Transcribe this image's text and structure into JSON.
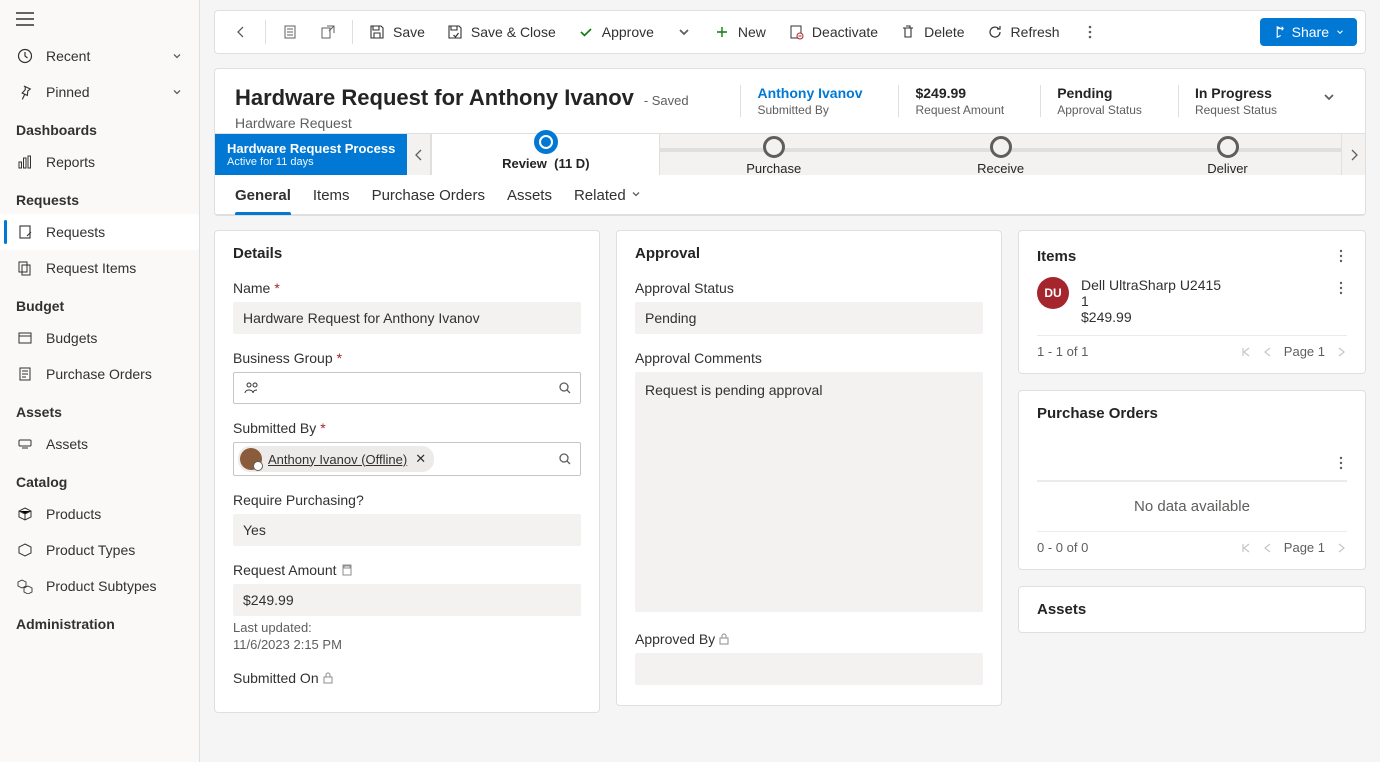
{
  "sidebar": {
    "recent": "Recent",
    "pinned": "Pinned",
    "sections": {
      "dashboards": {
        "header": "Dashboards",
        "reports": "Reports"
      },
      "requests": {
        "header": "Requests",
        "requests": "Requests",
        "request_items": "Request Items"
      },
      "budget": {
        "header": "Budget",
        "budgets": "Budgets",
        "purchase_orders": "Purchase Orders"
      },
      "assets": {
        "header": "Assets",
        "assets": "Assets"
      },
      "catalog": {
        "header": "Catalog",
        "products": "Products",
        "product_types": "Product Types",
        "product_subtypes": "Product Subtypes"
      },
      "administration": {
        "header": "Administration"
      }
    }
  },
  "commands": {
    "save": "Save",
    "save_close": "Save & Close",
    "approve": "Approve",
    "new": "New",
    "deactivate": "Deactivate",
    "delete": "Delete",
    "refresh": "Refresh",
    "share": "Share"
  },
  "record": {
    "title": "Hardware Request for Anthony Ivanov",
    "saved_state": "- Saved",
    "entity": "Hardware Request",
    "stats": {
      "submitted_by": {
        "value": "Anthony Ivanov",
        "label": "Submitted By"
      },
      "amount": {
        "value": "$249.99",
        "label": "Request Amount"
      },
      "approval": {
        "value": "Pending",
        "label": "Approval Status"
      },
      "status": {
        "value": "In Progress",
        "label": "Request Status"
      }
    }
  },
  "bpf": {
    "name": "Hardware Request Process",
    "duration": "Active for 11 days",
    "stages": {
      "review": "Review",
      "review_duration": "(11 D)",
      "purchase": "Purchase",
      "receive": "Receive",
      "deliver": "Deliver"
    }
  },
  "tabs": {
    "general": "General",
    "items": "Items",
    "purchase_orders": "Purchase Orders",
    "assets": "Assets",
    "related": "Related"
  },
  "details": {
    "section_title": "Details",
    "name_label": "Name",
    "name_value": "Hardware Request for Anthony Ivanov",
    "bg_label": "Business Group",
    "submitted_by_label": "Submitted By",
    "submitted_by_value": "Anthony Ivanov (Offline)",
    "require_purchasing_label": "Require Purchasing?",
    "require_purchasing_value": "Yes",
    "request_amount_label": "Request Amount",
    "request_amount_value": "$249.99",
    "last_updated_label": "Last updated:",
    "last_updated_value": "11/6/2023 2:15 PM",
    "submitted_on_label": "Submitted On"
  },
  "approval": {
    "section_title": "Approval",
    "status_label": "Approval Status",
    "status_value": "Pending",
    "comments_label": "Approval Comments",
    "comments_value": "Request is pending approval",
    "approved_by_label": "Approved By"
  },
  "items_card": {
    "title": "Items",
    "item": {
      "initials": "DU",
      "name": "Dell UltraSharp U2415",
      "qty": "1",
      "price": "$249.99"
    },
    "footer_count": "1 - 1 of 1",
    "page_label": "Page 1"
  },
  "po_card": {
    "title": "Purchase Orders",
    "no_data": "No data available",
    "footer_count": "0 - 0 of 0",
    "page_label": "Page 1"
  },
  "assets_card": {
    "title": "Assets"
  }
}
